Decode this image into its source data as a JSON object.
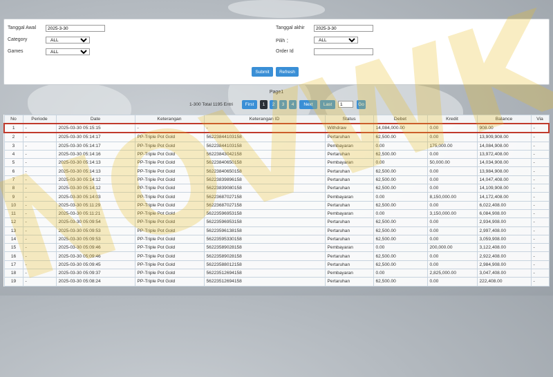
{
  "filter": {
    "tanggal_awal_label": "Tanggal Awal",
    "tanggal_awal_value": "2025-3-30",
    "category_label": "Category",
    "category_value": "ALL",
    "games_label": "Games",
    "games_value": "ALL",
    "tanggal_akhir_label": "Tanggal akhir",
    "tanggal_akhir_value": "2025-3-30",
    "pilih_label": "Pilih ：",
    "pilih_value": "ALL",
    "order_id_label": "Order Id",
    "order_id_value": "",
    "submit_label": "Submit",
    "refresh_label": "Refresh"
  },
  "pager": {
    "page_title": "Page1",
    "summary": "1-300 Total 1195 Entri",
    "first": "First",
    "pages": [
      "1",
      "2",
      "3",
      "4"
    ],
    "next": "Next",
    "last": "Last",
    "page_input": "1",
    "go": "Go"
  },
  "watermark": "NOVWK",
  "table": {
    "headers": [
      "No",
      "Periode",
      "Date",
      "Keterangan",
      "Keterangan ID",
      "Status",
      "Debet",
      "Kredit",
      "Balance",
      "Via"
    ],
    "rows": [
      [
        "1",
        "-",
        "2025-03-30 05:15:15",
        "-",
        "-",
        "Withdraw",
        "14,084,000.00",
        "0.00",
        "908.00",
        "-"
      ],
      [
        "2",
        "-",
        "2025-03-30 05:14:17",
        "PP-Triple Pot Gold",
        "56223844103158",
        "Pertaruhan",
        "62,500.00",
        "0.00",
        "13,909,908.00",
        "-"
      ],
      [
        "3",
        "-",
        "2025-03-30 05:14:17",
        "PP-Triple Pot Gold",
        "56223844103158",
        "Pembayaran",
        "0.00",
        "175,000.00",
        "14,084,908.00",
        "-"
      ],
      [
        "4",
        "-",
        "2025-03-30 05:14:16",
        "PP-Triple Pot Gold",
        "56223843042158",
        "Pertaruhan",
        "62,500.00",
        "0.00",
        "13,972,408.00",
        "-"
      ],
      [
        "5",
        "-",
        "2025-03-30 05:14:13",
        "PP-Triple Pot Gold",
        "56223840650158",
        "Pembayaran",
        "0.00",
        "50,000.00",
        "14,034,908.00",
        "-"
      ],
      [
        "6",
        "-",
        "2025-03-30 05:14:13",
        "PP-Triple Pot Gold",
        "56223840650158",
        "Pertaruhan",
        "62,500.00",
        "0.00",
        "13,984,908.00",
        "-"
      ],
      [
        "7",
        "-",
        "2025-03-30 05:14:12",
        "PP-Triple Pot Gold",
        "56223839896158",
        "Pertaruhan",
        "62,500.00",
        "0.00",
        "14,047,408.00",
        "-"
      ],
      [
        "8",
        "-",
        "2025-03-30 05:14:12",
        "PP-Triple Pot Gold",
        "56223839080158",
        "Pertaruhan",
        "62,500.00",
        "0.00",
        "14,109,908.00",
        "-"
      ],
      [
        "9",
        "-",
        "2025-03-30 05:14:03",
        "PP-Triple Pot Gold",
        "56223687027158",
        "Pembayaran",
        "0.00",
        "8,150,000.00",
        "14,172,408.00",
        "-"
      ],
      [
        "10",
        "-",
        "2025-03-30 05:11:29",
        "PP-Triple Pot Gold",
        "56223687027158",
        "Pertaruhan",
        "62,500.00",
        "0.00",
        "6,022,408.00",
        "-"
      ],
      [
        "11",
        "-",
        "2025-03-30 05:11:21",
        "PP-Triple Pot Gold",
        "56223596953158",
        "Pembayaran",
        "0.00",
        "3,150,000.00",
        "6,084,908.00",
        "-"
      ],
      [
        "12",
        "-",
        "2025-03-30 05:09:54",
        "PP-Triple Pot Gold",
        "56223596953158",
        "Pertaruhan",
        "62,500.00",
        "0.00",
        "2,934,908.00",
        "-"
      ],
      [
        "13",
        "-",
        "2025-03-30 05:09:53",
        "PP-Triple Pot Gold",
        "56223596138158",
        "Pertaruhan",
        "62,500.00",
        "0.00",
        "2,997,408.00",
        "-"
      ],
      [
        "14",
        "-",
        "2025-03-30 05:09:53",
        "PP-Triple Pot Gold",
        "56223595330158",
        "Pertaruhan",
        "62,500.00",
        "0.00",
        "3,059,908.00",
        "-"
      ],
      [
        "15",
        "-",
        "2025-03-30 05:09:46",
        "PP-Triple Pot Gold",
        "56223589028158",
        "Pembayaran",
        "0.00",
        "200,000.00",
        "3,122,408.00",
        "-"
      ],
      [
        "16",
        "-",
        "2025-03-30 05:09:46",
        "PP-Triple Pot Gold",
        "56223589028158",
        "Pertaruhan",
        "62,500.00",
        "0.00",
        "2,922,408.00",
        "-"
      ],
      [
        "17",
        "-",
        "2025-03-30 05:09:45",
        "PP-Triple Pot Gold",
        "56223588012158",
        "Pertaruhan",
        "62,500.00",
        "0.00",
        "2,984,908.00",
        "-"
      ],
      [
        "18",
        "-",
        "2025-03-30 05:09:37",
        "PP-Triple Pot Gold",
        "56223512694158",
        "Pembayaran",
        "0.00",
        "2,825,000.00",
        "3,047,408.00",
        "-"
      ],
      [
        "19",
        "-",
        "2025-03-30 05:08:24",
        "PP-Triple Pot Gold",
        "56223512694158",
        "Pertaruhan",
        "62,500.00",
        "0.00",
        "222,408.00",
        "-"
      ]
    ]
  }
}
